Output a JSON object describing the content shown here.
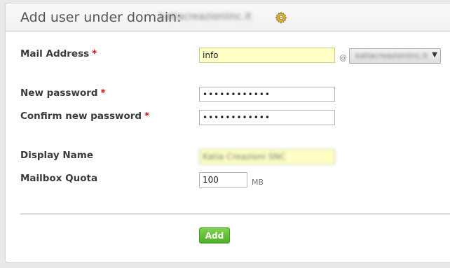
{
  "header": {
    "title": "Add user under domain:",
    "domain": "katiacreazioniinc.it"
  },
  "form": {
    "mail_address": {
      "label": "Mail Address",
      "required_mark": "*",
      "value": "info",
      "at_sign": "@",
      "domain_select_value": "katiacreazioniinc.it"
    },
    "new_password": {
      "label": "New password",
      "required_mark": "*",
      "value": "••••••••••••"
    },
    "confirm_password": {
      "label": "Confirm new password",
      "required_mark": "*",
      "value": "••••••••••••"
    },
    "display_name": {
      "label": "Display Name",
      "value": "Katia Creazioni SNC"
    },
    "mailbox_quota": {
      "label": "Mailbox Quota",
      "value": "100",
      "unit": "MB"
    }
  },
  "actions": {
    "add_label": "Add"
  },
  "colors": {
    "highlight_field": "#ffffc6",
    "required": "#cc1111",
    "add_button": "#5cb82f"
  },
  "icons": {
    "header_icon": "gear-icon",
    "select_arrow": "chevron-down-icon"
  }
}
